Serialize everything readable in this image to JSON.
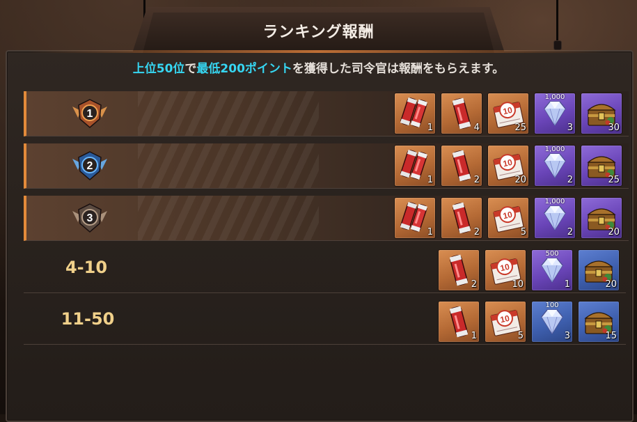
{
  "title": "ランキング報酬",
  "subtitle": {
    "part1": "上位50位",
    "part2": "で",
    "part3": "最低200ポイント",
    "part4": "を獲得した司令官は報酬をもらえます。"
  },
  "colors": {
    "highlight": "#36d6f2",
    "rank_text": "#f0d08a",
    "row_accent": "#e38a3a"
  },
  "rows": [
    {
      "rank": "1",
      "items": [
        {
          "icon": "double-cylinder-icon",
          "qty": "1",
          "bg": "orange"
        },
        {
          "icon": "cylinder-icon",
          "qty": "4",
          "bg": "orange"
        },
        {
          "icon": "ticket-10-icon",
          "qty": "25",
          "bg": "orange"
        },
        {
          "icon": "diamond-icon",
          "qty": "3",
          "top": "1,000",
          "bg": "purple"
        },
        {
          "icon": "treasure-chest-icon",
          "qty": "30",
          "bg": "purple"
        }
      ]
    },
    {
      "rank": "2",
      "items": [
        {
          "icon": "double-cylinder-icon",
          "qty": "1",
          "bg": "orange"
        },
        {
          "icon": "cylinder-icon",
          "qty": "2",
          "bg": "orange"
        },
        {
          "icon": "ticket-10-icon",
          "qty": "20",
          "bg": "orange"
        },
        {
          "icon": "diamond-icon",
          "qty": "2",
          "top": "1,000",
          "bg": "purple"
        },
        {
          "icon": "treasure-chest-icon",
          "qty": "25",
          "bg": "purple"
        }
      ]
    },
    {
      "rank": "3",
      "items": [
        {
          "icon": "double-cylinder-icon",
          "qty": "1",
          "bg": "orange"
        },
        {
          "icon": "cylinder-icon",
          "qty": "2",
          "bg": "orange"
        },
        {
          "icon": "ticket-10-icon",
          "qty": "5",
          "bg": "orange"
        },
        {
          "icon": "diamond-icon",
          "qty": "2",
          "top": "1,000",
          "bg": "purple"
        },
        {
          "icon": "treasure-chest-icon",
          "qty": "20",
          "bg": "purple"
        }
      ]
    },
    {
      "rank": "4-10",
      "items": [
        {
          "icon": "cylinder-icon",
          "qty": "2",
          "bg": "orange"
        },
        {
          "icon": "ticket-10-icon",
          "qty": "10",
          "bg": "orange"
        },
        {
          "icon": "diamond-icon",
          "qty": "1",
          "top": "500",
          "bg": "purple"
        },
        {
          "icon": "treasure-chest-icon",
          "qty": "20",
          "bg": "blue"
        }
      ]
    },
    {
      "rank": "11-50",
      "items": [
        {
          "icon": "cylinder-icon",
          "qty": "1",
          "bg": "orange"
        },
        {
          "icon": "ticket-10-icon",
          "qty": "5",
          "bg": "orange"
        },
        {
          "icon": "diamond-icon",
          "qty": "3",
          "top": "100",
          "bg": "blue"
        },
        {
          "icon": "treasure-chest-icon",
          "qty": "15",
          "bg": "blue"
        }
      ]
    }
  ]
}
